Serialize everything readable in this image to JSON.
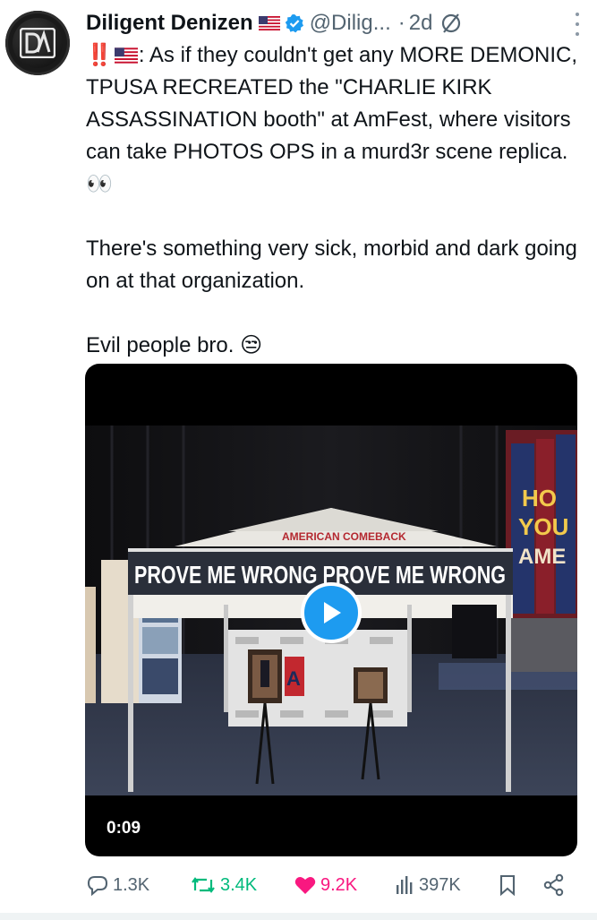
{
  "post": {
    "author_name": "Diligent Denizen",
    "author_handle": "@Dilig...",
    "separator": "·",
    "time_ago": "2d",
    "lines": [
      ": As if they couldn't get any MORE DEMONIC, TPUSA RECREATED the \"CHARLIE KIRK ASSASSINATION booth\" at AmFest, where visitors can take PHOTOS OPS in a murd3r scene replica. 👀",
      "There's something very sick, morbid and dark going on at that organization.",
      "Evil people bro. 😒"
    ],
    "prefix_emoji": "‼️"
  },
  "video": {
    "duration": "0:09",
    "banner_text": "PROVE ME WRONG  PROVE ME WRONG",
    "tent_label": "AMERICAN COMEBACK",
    "truck_text": "HONK IF YOU LOVE AMERICA"
  },
  "actions": {
    "replies": "1.3K",
    "reposts": "3.4K",
    "likes": "9.2K",
    "views": "397K"
  },
  "colors": {
    "like": "#f91880",
    "repost": "#00ba7c",
    "accent": "#1d9bf0",
    "muted": "#536471"
  },
  "icons": [
    "reply-icon",
    "repost-icon",
    "heart-icon",
    "views-icon",
    "bookmark-icon",
    "share-icon",
    "verified-icon",
    "mute-icon",
    "more-icon",
    "play-icon"
  ]
}
